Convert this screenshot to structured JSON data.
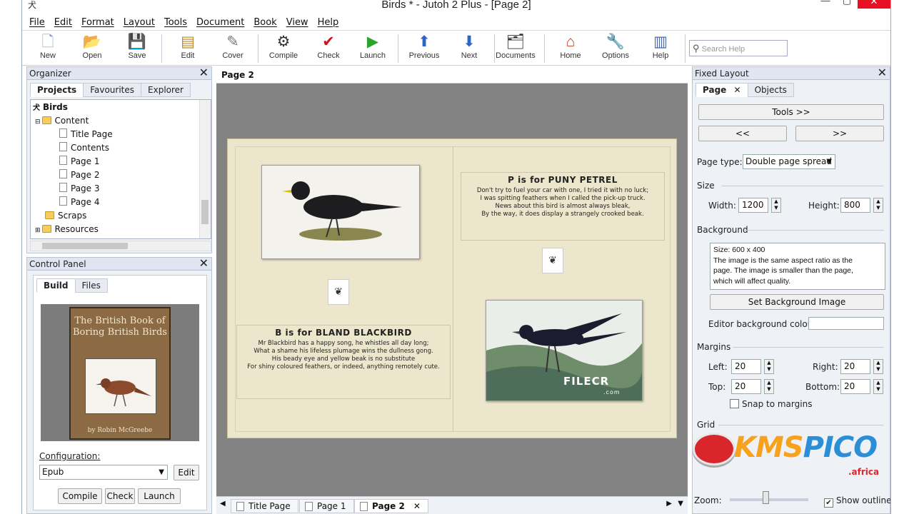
{
  "window": {
    "title": "Birds * - Jutoh 2 Plus - [Page 2]",
    "app_icon": "犬"
  },
  "menu": [
    "File",
    "Edit",
    "Format",
    "Layout",
    "Tools",
    "Document",
    "Book",
    "View",
    "Help"
  ],
  "toolbar": {
    "buttons": [
      {
        "label": "New",
        "icon": "new-document-icon",
        "glyph": "🗋"
      },
      {
        "label": "Open",
        "icon": "open-folder-icon",
        "glyph": "📂"
      },
      {
        "label": "Save",
        "icon": "save-icon",
        "glyph": "💾"
      },
      {
        "label": "Edit",
        "icon": "edit-icon",
        "glyph": "▤"
      },
      {
        "label": "Cover",
        "icon": "cover-icon",
        "glyph": "✎"
      },
      {
        "label": "Compile",
        "icon": "gear-icon",
        "glyph": "⚙"
      },
      {
        "label": "Check",
        "icon": "check-icon",
        "glyph": "✔"
      },
      {
        "label": "Launch",
        "icon": "play-icon",
        "glyph": "▶"
      },
      {
        "label": "Previous",
        "icon": "arrow-up-icon",
        "glyph": "⬆"
      },
      {
        "label": "Next",
        "icon": "arrow-down-icon",
        "glyph": "⬇"
      },
      {
        "label": "Documents",
        "icon": "documents-icon",
        "glyph": "🗂"
      },
      {
        "label": "Home",
        "icon": "home-icon",
        "glyph": "⌂"
      },
      {
        "label": "Options",
        "icon": "wrench-icon",
        "glyph": "🔧"
      },
      {
        "label": "Help",
        "icon": "books-icon",
        "glyph": "▥"
      }
    ],
    "search_placeholder": "Search Help"
  },
  "organizer": {
    "title": "Organizer",
    "tabs": [
      "Projects",
      "Favourites",
      "Explorer"
    ],
    "tree": {
      "root": "Birds",
      "content": "Content",
      "pages": [
        "Title Page",
        "Contents",
        "Page 1",
        "Page 2",
        "Page 3",
        "Page 4"
      ],
      "scraps": "Scraps",
      "resources": "Resources"
    }
  },
  "control_panel": {
    "title": "Control Panel",
    "tabs": [
      "Build",
      "Files"
    ],
    "cover": {
      "title": "The British Book of Boring British Birds",
      "author": "by Robin McGreebe"
    },
    "configuration_label": "Configuration:",
    "configuration_value": "Epub",
    "edit_label": "Edit",
    "buttons": [
      "Compile",
      "Check",
      "Launch"
    ]
  },
  "editor": {
    "header": "Page 2",
    "left_heading": "B is for BLAND BLACKBIRD",
    "left_text": [
      "Mr Blackbird has a happy song, he whistles all day long;",
      "What a shame his lifeless plumage wins the dullness gong.",
      "His beady eye and yellow beak is no substitute",
      "For shiny coloured feathers, or indeed, anything remotely cute."
    ],
    "right_heading": "P is for PUNY PETREL",
    "right_text": [
      "Don't try to fuel your car with one, I tried it with no luck;",
      "I was spitting feathers when I called the pick-up truck.",
      "News about this bird is almost always bleak,",
      "By the way, it does display a strangely crooked beak."
    ],
    "watermark": "FILECR",
    "watermark_sub": ".com",
    "doc_tabs": [
      "Title Page",
      "Page 1",
      "Page 2"
    ]
  },
  "fixed_layout": {
    "title": "Fixed Layout",
    "tabs": [
      "Page",
      "Objects"
    ],
    "tools_label": "Tools >>",
    "prev_label": "<<",
    "next_label": ">>",
    "page_type_label": "Page type:",
    "page_type_value": "Double page spread",
    "size_label": "Size",
    "width_label": "Width:",
    "width_value": "1200",
    "height_label": "Height:",
    "height_value": "800",
    "background_label": "Background",
    "background_info": "Size: 600 x 400\nThe image is the same aspect ratio as the page. The image is smaller than the page, which will affect quality.",
    "set_bg_label": "Set Background Image",
    "editor_bg_label": "Editor background colour:",
    "margins_label": "Margins",
    "left_label": "Left:",
    "left_value": "20",
    "right_label": "Right:",
    "right_value": "20",
    "top_label": "Top:",
    "top_value": "20",
    "bottom_label": "Bottom:",
    "bottom_value": "20",
    "snap_label": "Snap to margins",
    "grid_label": "Grid",
    "zoom_label": "Zoom:",
    "show_outlines_label": "Show outlines"
  },
  "kms_watermark": {
    "text1": "KMS",
    "text2": "PICO",
    "sub": ".africa"
  },
  "colors": {
    "accent": "#2a66c5",
    "close": "#e81123",
    "page_bg": "#ece6cc"
  }
}
